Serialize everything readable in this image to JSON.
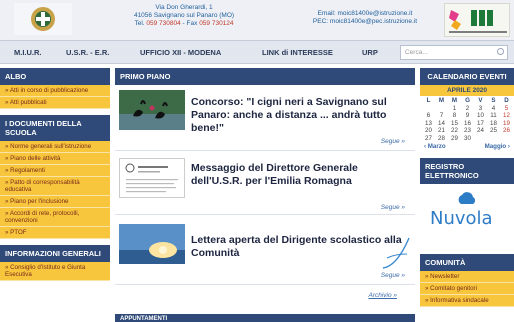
{
  "header": {
    "address_line1": "Via Don Gherardi, 1",
    "address_line2": "41056 Savignano sul Panaro (MO)",
    "tel_label": "Tel.",
    "tel": "059 730804",
    "fax_label": "Fax",
    "fax": "059 730124",
    "email": "Email: moic81400e@istruzione.it",
    "pec": "PEC: moic81400e@pec.istruzione.it"
  },
  "nav": {
    "items": [
      "M.I.U.R.",
      "U.S.R. - E.R.",
      "UFFICIO XII - MODENA",
      "LINK di INTERESSE",
      "URP"
    ],
    "search_placeholder": "Cerca..."
  },
  "left": {
    "albo": {
      "title": "ALBO",
      "items": [
        "Atti in corso di pubblicazione",
        "Atti pubblicati"
      ]
    },
    "documenti": {
      "title": "I DOCUMENTI DELLA SCUOLA",
      "items": [
        "Norme generali sull'istruzione",
        "Piano delle attività",
        "Regolamenti",
        "Patto di corresponsabilità educativa",
        "Piano per l'inclusione",
        "Accordi di rete, protocolli, convenzioni",
        "PTOF"
      ]
    },
    "informazioni": {
      "title": "INFORMAZIONI GENERALI",
      "items": [
        "Consiglio d'Istituto e Giunta Esecutiva"
      ]
    }
  },
  "main": {
    "title": "PRIMO PIANO",
    "news": [
      {
        "title": "Concorso: \"I cigni neri a Savignano sul Panaro: anche a distanza ... andrà tutto bene!\"",
        "more": "Segue »"
      },
      {
        "title": "Messaggio del Direttore Generale dell'U.S.R. per l'Emilia Romagna",
        "more": "Segue »"
      },
      {
        "title": "Lettera aperta del Dirigente scolastico alla Comunità",
        "more": "Segue »"
      }
    ],
    "archive": "Archivio »",
    "next_section": "APPUNTAMENTI"
  },
  "right": {
    "calendar": {
      "title": "CALENDARIO EVENTI",
      "month": "APRILE 2020",
      "weekdays": [
        "L",
        "M",
        "M",
        "G",
        "V",
        "S",
        "D"
      ],
      "rows": [
        [
          "",
          "",
          "1",
          "2",
          "3",
          "4",
          "5"
        ],
        [
          "6",
          "7",
          "8",
          "9",
          "10",
          "11",
          "12"
        ],
        [
          "13",
          "14",
          "15",
          "16",
          "17",
          "18",
          "19"
        ],
        [
          "20",
          "21",
          "22",
          "23",
          "24",
          "25",
          "26"
        ],
        [
          "27",
          "28",
          "29",
          "30",
          "",
          "",
          ""
        ]
      ],
      "prev": "‹ Marzo",
      "next": "Maggio ›"
    },
    "registro": {
      "title": "REGISTRO ELETTRONICO",
      "brand": "Nuvola"
    },
    "comunita": {
      "title": "COMUNITÀ",
      "items": [
        "Newsletter",
        "Comitato genitori",
        "Informativa sindacale"
      ]
    }
  },
  "colors": {
    "header_bg": "#eef0f6",
    "box_head": "#2f4a78",
    "sidebar_yellow": "#f7c63d",
    "link_blue": "#3b6aa8",
    "nuvola_blue": "#2d7dc6"
  }
}
